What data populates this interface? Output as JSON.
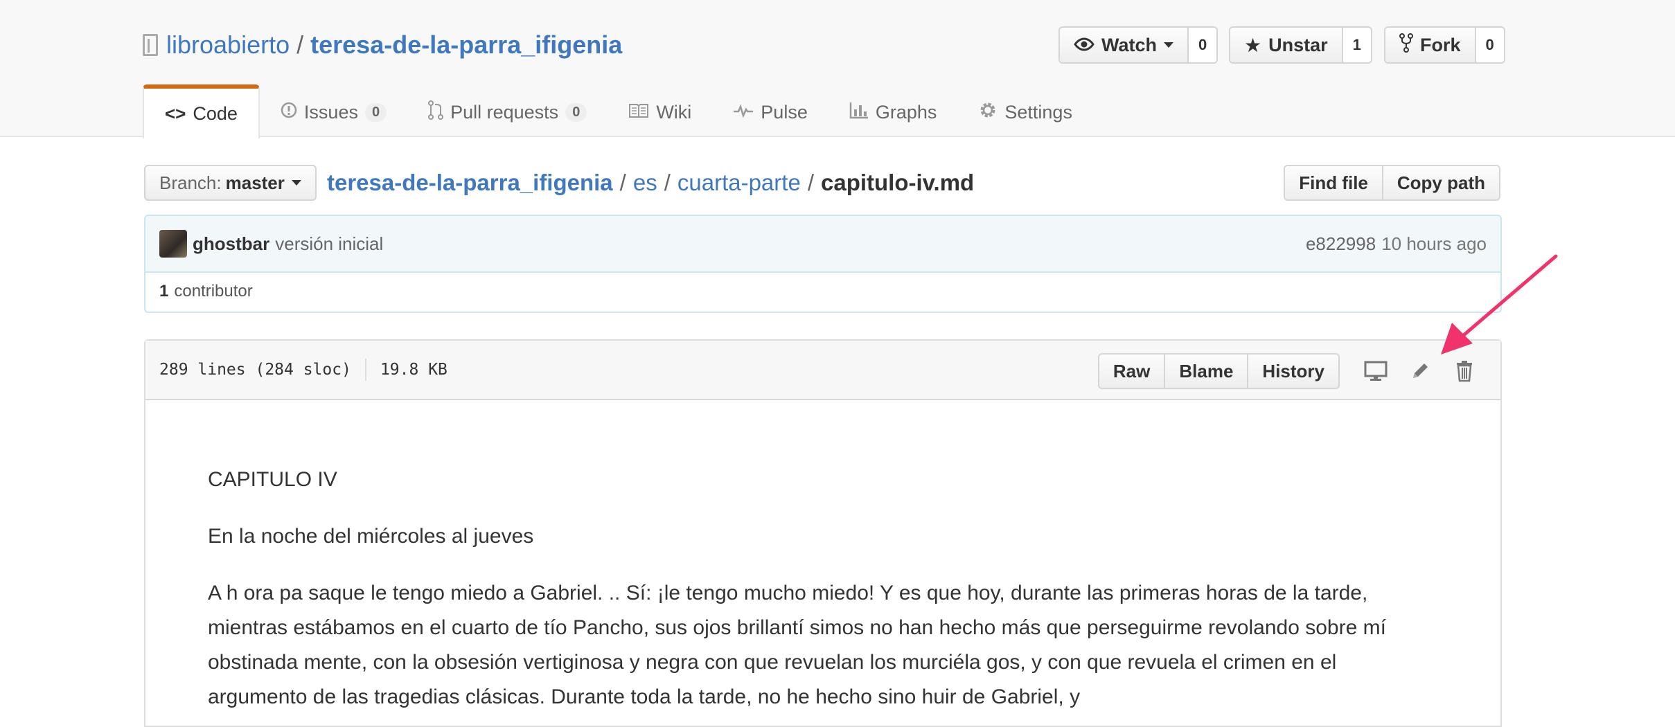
{
  "repo": {
    "owner": "libroabierto",
    "separator": "/",
    "name": "teresa-de-la-parra_ifigenia"
  },
  "social": {
    "watch": {
      "label": "Watch",
      "count": "0"
    },
    "star": {
      "label": "Unstar",
      "count": "1"
    },
    "fork": {
      "label": "Fork",
      "count": "0"
    }
  },
  "tabs": [
    {
      "label": "Code",
      "icon": "code-icon",
      "selected": true
    },
    {
      "label": "Issues",
      "icon": "issue-icon",
      "counter": "0"
    },
    {
      "label": "Pull requests",
      "icon": "pull-request-icon",
      "counter": "0"
    },
    {
      "label": "Wiki",
      "icon": "book-icon"
    },
    {
      "label": "Pulse",
      "icon": "pulse-icon"
    },
    {
      "label": "Graphs",
      "icon": "graph-icon"
    },
    {
      "label": "Settings",
      "icon": "gear-icon"
    }
  ],
  "branch": {
    "label": "Branch:",
    "value": "master"
  },
  "breadcrumb": {
    "root": "teresa-de-la-parra_ifigenia",
    "parts": [
      "es",
      "cuarta-parte"
    ],
    "separator": "/",
    "final": "capitulo-iv.md"
  },
  "file_nav": {
    "find": "Find file",
    "copy": "Copy path"
  },
  "commit": {
    "author": "ghostbar",
    "message": "versión inicial",
    "sha": "e822998",
    "time": "10 hours ago"
  },
  "contributors": {
    "count": "1",
    "label": "contributor"
  },
  "file": {
    "lines": "289 lines (284 sloc)",
    "size": "19.8 KB",
    "actions": {
      "raw": "Raw",
      "blame": "Blame",
      "history": "History"
    },
    "icons": [
      "desktop-icon",
      "pencil-icon",
      "trashcan-icon"
    ]
  },
  "content": [
    "CAPITULO IV",
    "En la noche del miércoles al jueves",
    "A h ora pa saque le tengo miedo a Gabriel. .. Sí: ¡le tengo mucho miedo! Y es que hoy, durante las primeras horas de la tarde, mientras estábamos en el cuarto de tío Pancho, sus ojos brillantí simos no han hecho más que perseguirme revolando sobre mí obstinada mente, con la obsesión vertiginosa y negra con que revuelan los murciéla gos, y con que revuela el crimen en el argumento de las tragedias clásicas. Durante toda la tarde, no he hecho sino huir de Gabriel, y"
  ],
  "colors": {
    "link": "#4078c0",
    "tab_accent": "#d26911",
    "annotation_arrow": "#f0336a",
    "commit_bg": "#f2f8fa"
  }
}
